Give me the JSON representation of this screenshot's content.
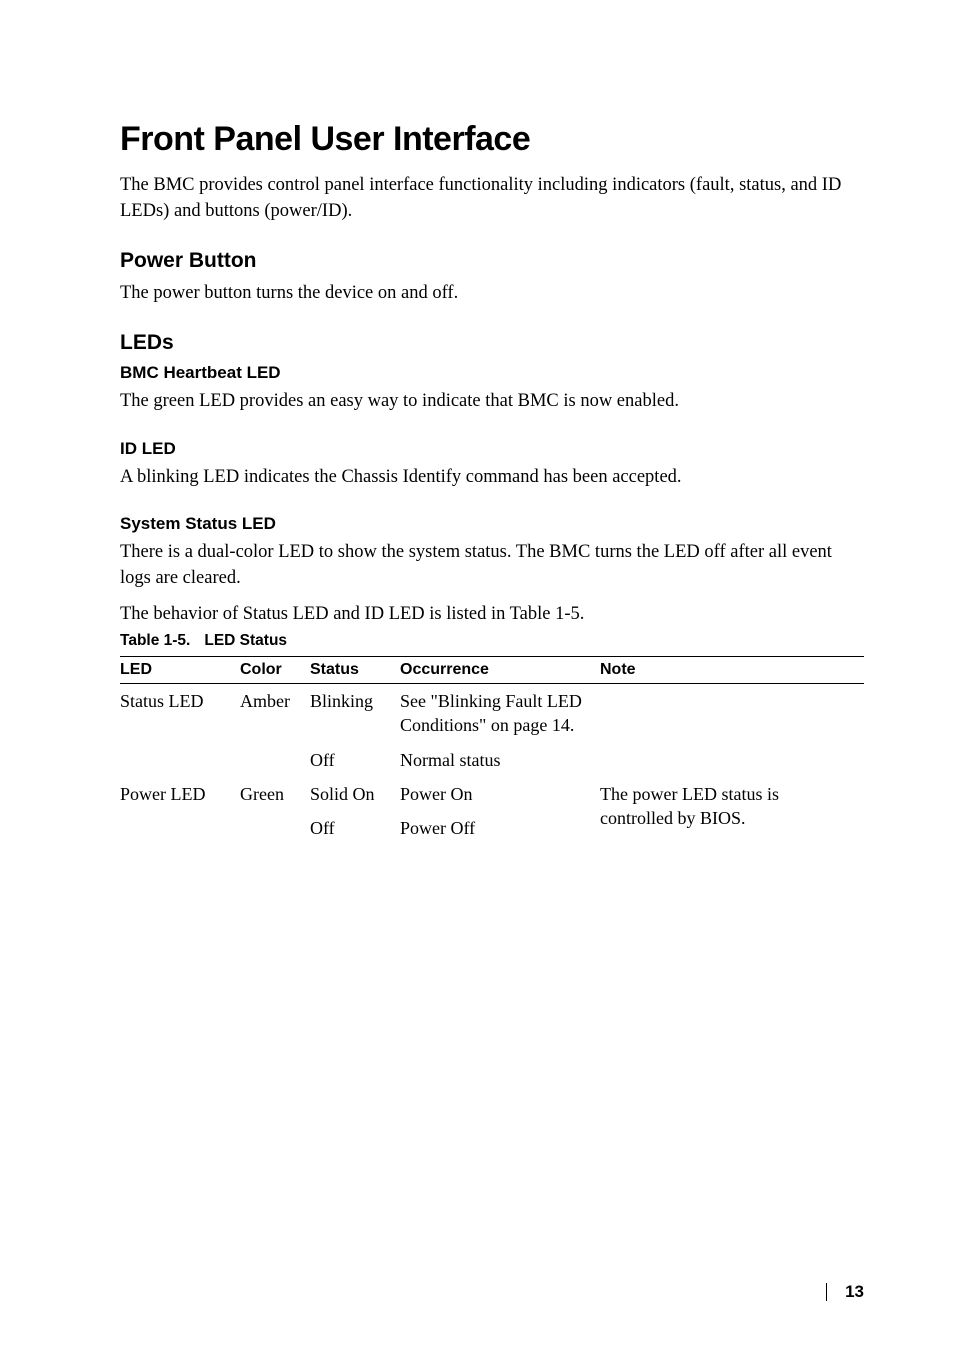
{
  "title": "Front Panel User Interface",
  "intro": "The BMC provides control panel interface functionality including indicators (fault, status, and ID LEDs) and buttons (power/ID).",
  "sections": {
    "power_button": {
      "heading": "Power Button",
      "text": "The power button turns the device on and off."
    },
    "leds": {
      "heading": "LEDs",
      "bmc": {
        "heading": "BMC Heartbeat LED",
        "text": "The green LED provides an easy way to indicate that BMC is now enabled."
      },
      "id": {
        "heading": "ID LED",
        "text": "A blinking LED indicates the Chassis Identify command has been accepted."
      },
      "status": {
        "heading": "System Status LED",
        "text1": "There is a dual-color LED to show the system status. The BMC turns the LED off after all event logs are cleared.",
        "text2": "The behavior of Status LED and ID LED is listed in Table 1-5."
      }
    }
  },
  "table": {
    "caption_num": "Table 1-5.",
    "caption_title": "LED Status",
    "headers": {
      "led": "LED",
      "color": "Color",
      "status": "Status",
      "occurrence": "Occurrence",
      "note": "Note"
    },
    "rows": [
      {
        "led": "Status LED",
        "color": "Amber",
        "status": "Blinking",
        "occurrence": "See \"Blinking Fault LED Conditions\" on page 14.",
        "note": ""
      },
      {
        "led": "",
        "color": "",
        "status": "Off",
        "occurrence": "Normal status",
        "note": ""
      },
      {
        "led": "Power LED",
        "color": "Green",
        "status": "Solid On",
        "occurrence": "Power On",
        "note": "The power LED status is controlled by BIOS."
      },
      {
        "led": "",
        "color": "",
        "status": "Off",
        "occurrence": "Power Off",
        "note": ""
      }
    ]
  },
  "page_number": "13"
}
